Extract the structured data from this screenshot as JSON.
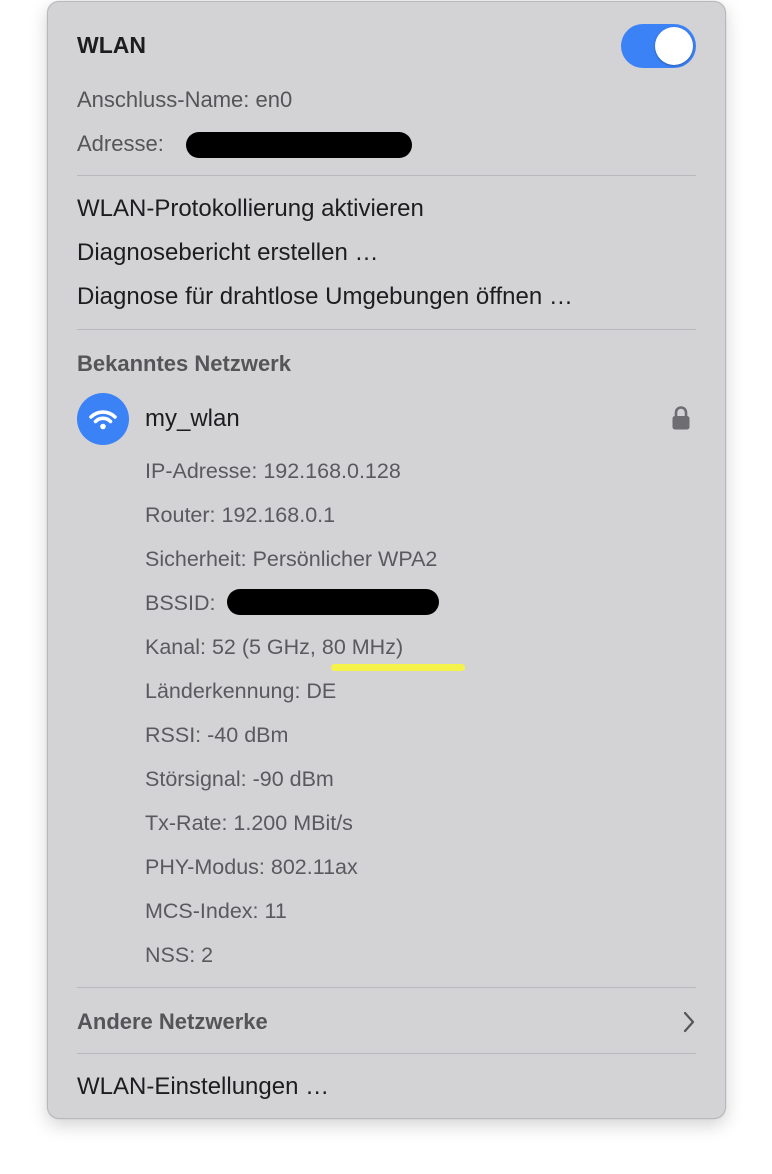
{
  "header": {
    "title": "WLAN",
    "toggle_state": "on"
  },
  "interface": {
    "name_label": "Anschluss-Name:",
    "name_value": "en0",
    "address_label": "Adresse:"
  },
  "menu": {
    "logging": "WLAN-Protokollierung aktivieren",
    "diag_report": "Diagnosebericht erstellen …",
    "diag_wireless": "Diagnose für drahtlose Umgebungen öffnen …"
  },
  "known": {
    "section_title": "Bekanntes Netzwerk",
    "network_name": "my_wlan",
    "details": {
      "ip_label": "IP-Adresse:",
      "ip_value": "192.168.0.128",
      "router_label": "Router:",
      "router_value": "192.168.0.1",
      "security_label": "Sicherheit:",
      "security_value": "Persönlicher WPA2",
      "bssid_label": "BSSID:",
      "channel_label": "Kanal:",
      "channel_value": "52 (5 GHz, 80 MHz)",
      "country_label": "Länderkennung:",
      "country_value": "DE",
      "rssi_label": "RSSI:",
      "rssi_value": "-40 dBm",
      "noise_label": "Störsignal:",
      "noise_value": "-90 dBm",
      "txrate_label": "Tx-Rate:",
      "txrate_value": "1.200 MBit/s",
      "phy_label": "PHY-Modus:",
      "phy_value": "802.11ax",
      "mcs_label": "MCS-Index:",
      "mcs_value": "11",
      "nss_label": "NSS:",
      "nss_value": "2"
    }
  },
  "other_networks": "Andere Netzwerke",
  "settings": "WLAN-Einstellungen …",
  "colors": {
    "accent": "#3b82f6",
    "panel": "#d3d3d6",
    "highlight": "#f5f34a"
  },
  "icons": [
    "wifi-icon",
    "lock-icon",
    "chevron-right-icon"
  ]
}
